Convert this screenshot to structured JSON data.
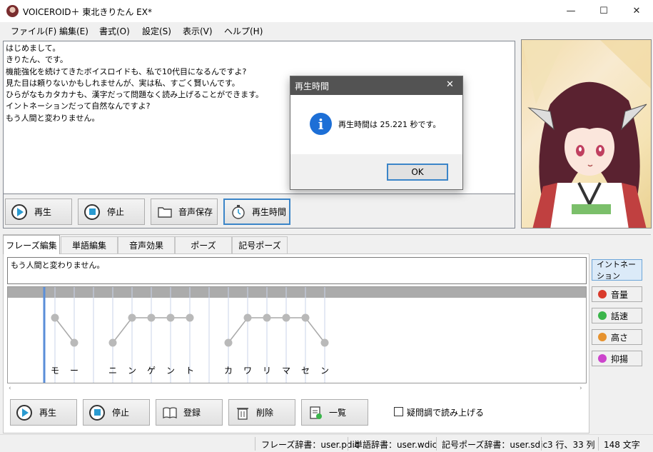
{
  "window": {
    "title": "VOICEROID＋ 東北きりたん EX*",
    "minimize": "—",
    "maximize": "☐",
    "close": "✕"
  },
  "menu": [
    "ファイル(F)",
    "編集(E)",
    "書式(O)",
    "設定(S)",
    "表示(V)",
    "ヘルプ(H)"
  ],
  "main_text": [
    "はじめまして。",
    "きりたん、です。",
    "機能強化を続けてきたボイスロイドも、私で10代目になるんですよ?",
    "見た目は頼りないかもしれませんが、実は私、すごく賢いんです。",
    "ひらがなもカタカナも、漢字だって問題なく読み上げることができます。",
    "イントネーションだって自然なんですよ?",
    "もう人間と変わりません。"
  ],
  "top_buttons": {
    "play": "再生",
    "stop": "停止",
    "save_audio": "音声保存",
    "play_time": "再生時間"
  },
  "tabs": [
    "フレーズ編集",
    "単語編集",
    "音声効果",
    "ポーズ",
    "記号ポーズ"
  ],
  "phrase_input": "もう人間と変わりません。",
  "side_buttons": {
    "intonation": "イントネーション",
    "volume": "音量",
    "speed": "話速",
    "pitch": "高さ",
    "emphasis": "抑揚"
  },
  "colors": {
    "volume": "#d93a2b",
    "speed": "#3ab54a",
    "pitch": "#e6922e",
    "emphasis": "#cc44cc",
    "accent": "#0078d7"
  },
  "kana": [
    "モ",
    "ー",
    "ニ",
    "ン",
    "ゲ",
    "ン",
    "ト",
    "カ",
    "ワ",
    "リ",
    "マ",
    "セ",
    "ン"
  ],
  "bottom_buttons": {
    "play": "再生",
    "stop": "停止",
    "register": "登録",
    "delete": "削除",
    "list": "一覧"
  },
  "question_checkbox": {
    "label": "疑問調で読み上げる",
    "checked": false
  },
  "dialog": {
    "title": "再生時間",
    "message": "再生時間は 25.221 秒です。",
    "ok": "OK",
    "close": "✕"
  },
  "status": {
    "phrase_dict": "フレーズ辞書：user.pdic",
    "word_dict": "単語辞書：user.wdic",
    "symbol_dict": "記号ポーズ辞書：user.sdic",
    "cursor": "3 行、33 列",
    "chars": "148 文字"
  }
}
